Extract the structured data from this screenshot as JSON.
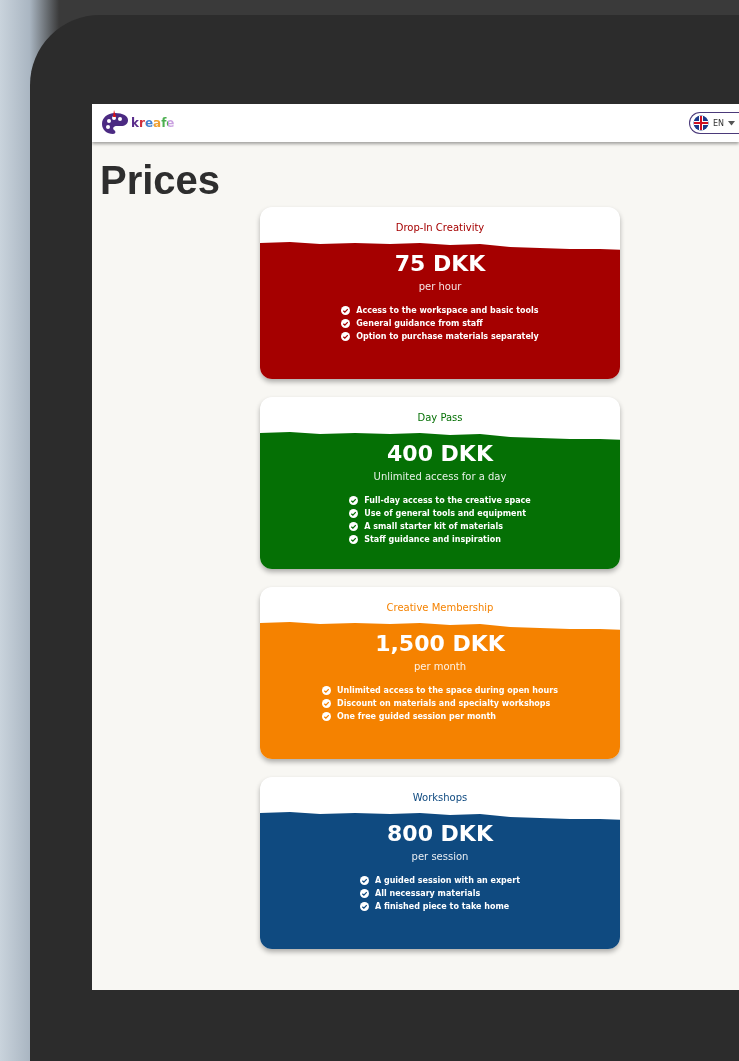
{
  "header": {
    "logo_text": "kreafe",
    "language": {
      "label": "EN"
    }
  },
  "page_title": "Prices",
  "plans": [
    {
      "name": "Drop-In Creativity",
      "color": "#a50000",
      "price": "75 DKK",
      "period": "per hour",
      "features": [
        "Access to the workspace and basic tools",
        "General guidance from staff",
        "Option to purchase materials separately"
      ]
    },
    {
      "name": "Day Pass",
      "color": "#057005",
      "price": "400 DKK",
      "period": "Unlimited access for a day",
      "features": [
        "Full-day access to the creative space",
        "Use of general tools and equipment",
        "A small starter kit of materials",
        "Staff guidance and inspiration"
      ]
    },
    {
      "name": "Creative Membership",
      "color": "#f58200",
      "price": "1,500 DKK",
      "period": "per month",
      "features": [
        "Unlimited access to the space during open hours",
        "Discount on materials and specialty workshops",
        "One free guided session per month"
      ]
    },
    {
      "name": "Workshops",
      "color": "#0f4a80",
      "price": "800 DKK",
      "period": "per session",
      "features": [
        "A guided session with an expert",
        "All necessary materials",
        "A finished piece to take home"
      ]
    }
  ]
}
